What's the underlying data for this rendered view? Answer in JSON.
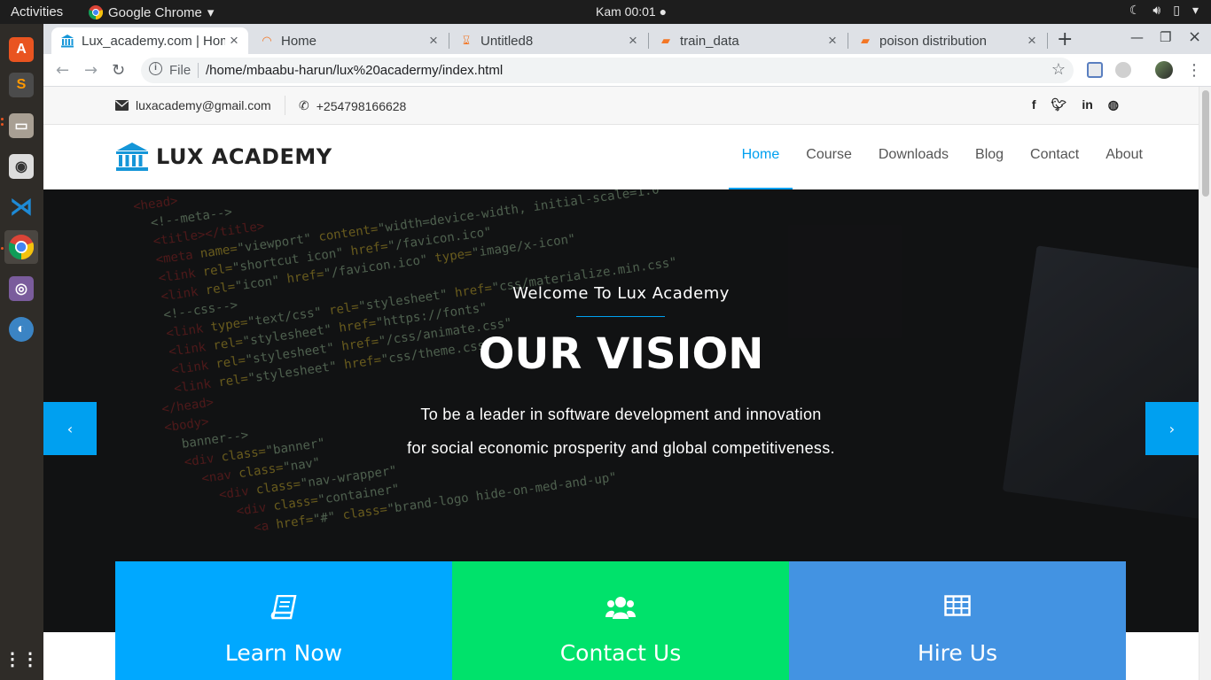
{
  "system": {
    "activities": "Activities",
    "app_name": "Google Chrome",
    "clock": "Kam 00:01 ●"
  },
  "browser": {
    "tabs": [
      {
        "title": "Lux_academy.com | Home",
        "favicon": "bank-icon",
        "active": true
      },
      {
        "title": "Home",
        "favicon": "jupyter-icon",
        "active": false
      },
      {
        "title": "Untitled8",
        "favicon": "hourglass-icon",
        "active": false
      },
      {
        "title": "train_data",
        "favicon": "notebook-icon",
        "active": false
      },
      {
        "title": "poison distribution",
        "favicon": "notebook-icon",
        "active": false
      }
    ],
    "address": {
      "scheme": "File",
      "url": "/home/mbaabu-harun/lux%20acadermy/index.html"
    }
  },
  "page": {
    "contact": {
      "email": "luxacademy@gmail.com",
      "phone": "+254798166628"
    },
    "socials": [
      "f",
      "t",
      "in",
      "gh"
    ],
    "brand": "LUX ACADEMY",
    "menu": [
      "Home",
      "Course",
      "Downloads",
      "Blog",
      "Contact",
      "About"
    ],
    "active_menu": "Home",
    "hero": {
      "welcome": "Welcome To Lux Academy",
      "heading": "OUR VISION",
      "line1": "To be a leader in software development and innovation",
      "line2": "for social economic prosperity and global competitiveness."
    },
    "features": [
      {
        "title": "Learn Now",
        "icon": "book-icon",
        "color": "#00a8ff"
      },
      {
        "title": "Contact Us",
        "icon": "users-icon",
        "color": "#00e26b"
      },
      {
        "title": "Hire Us",
        "icon": "table-icon",
        "color": "#4393e2"
      }
    ]
  },
  "colors": {
    "accent": "#00a0f0",
    "topbar": "#1d1d1d",
    "dock": "#2f2c28"
  }
}
